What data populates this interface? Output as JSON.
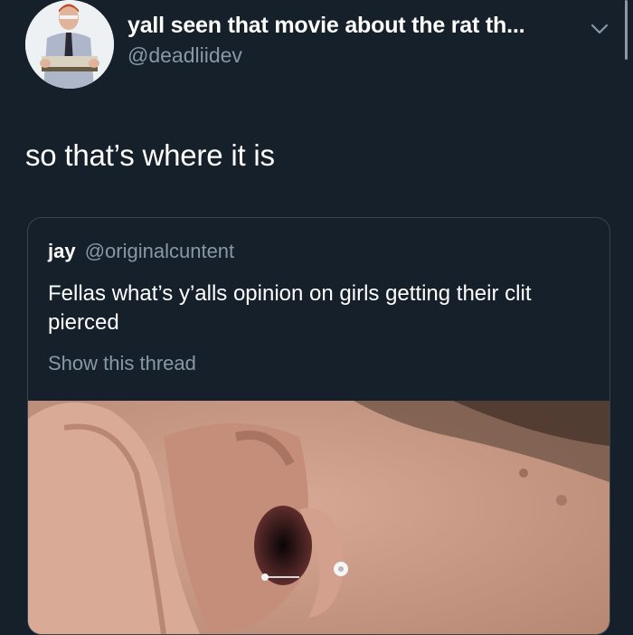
{
  "tweet": {
    "display_name": "yall seen that movie about the rat th...",
    "handle": "@deadliidev",
    "text": "so that’s where it is"
  },
  "quoted": {
    "name": "jay",
    "handle": "@originalcuntent",
    "body": "Fellas what’s y’alls opinion on girls getting their clit pierced",
    "show_thread": "Show this thread"
  },
  "icons": {
    "menu": "chevron-down-icon",
    "avatar": "avatar-image"
  },
  "colors": {
    "background": "#15202b",
    "text": "#ffffff",
    "secondary": "#8899a6",
    "border": "#38444d"
  }
}
